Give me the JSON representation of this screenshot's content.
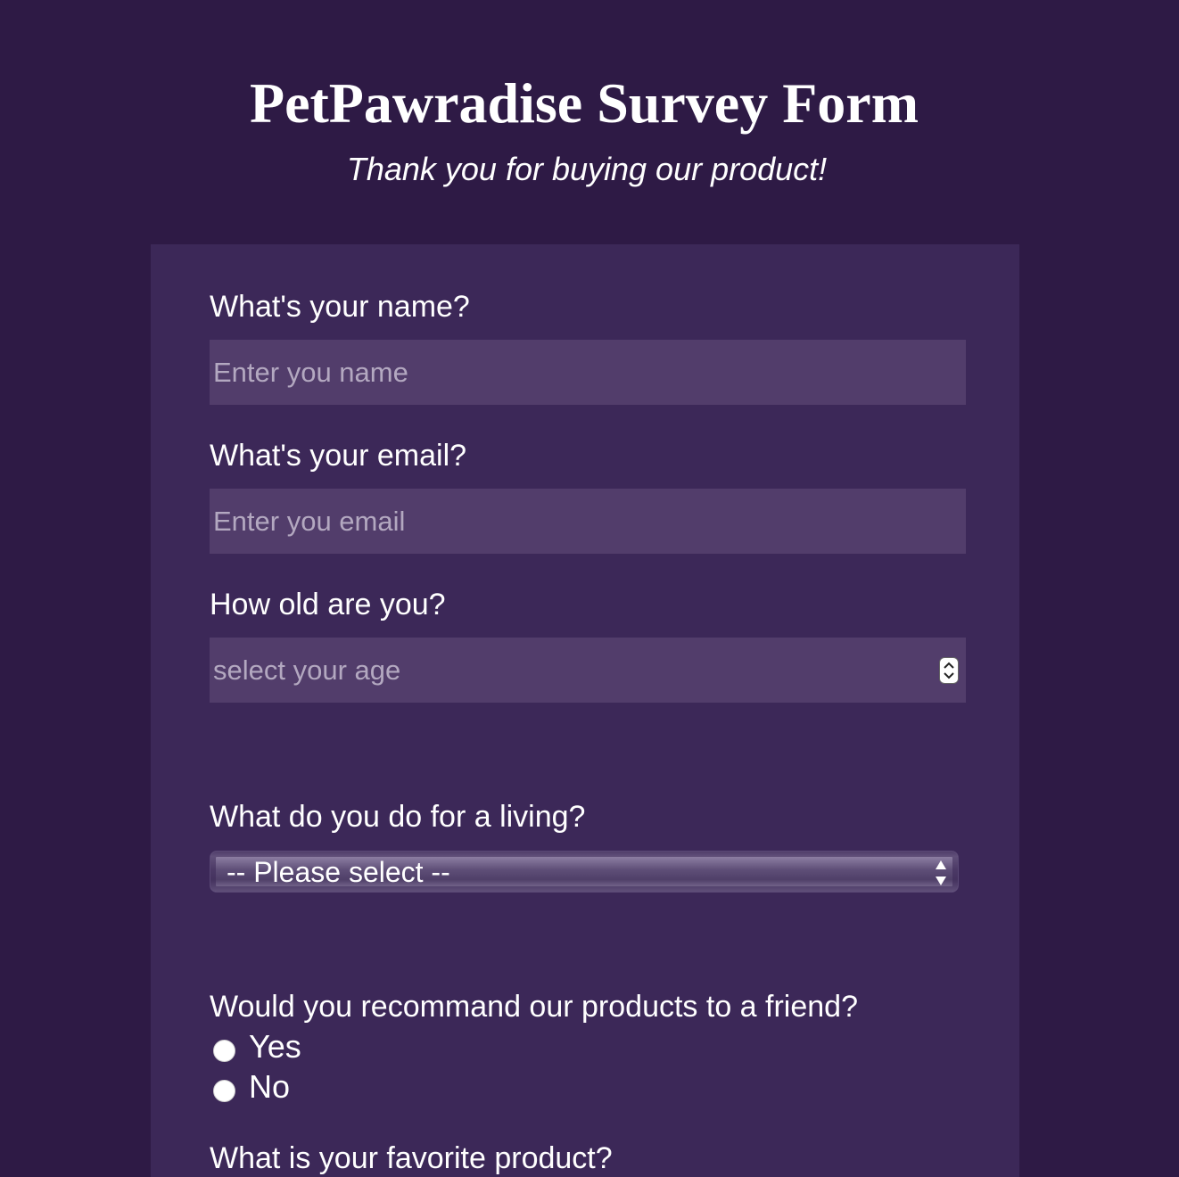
{
  "header": {
    "title": "PetPawradise Survey Form",
    "subtitle": "Thank you for buying our product!"
  },
  "form": {
    "name": {
      "label": "What's your name?",
      "placeholder": "Enter you name"
    },
    "email": {
      "label": "What's your email?",
      "placeholder": "Enter you email"
    },
    "age": {
      "label": "How old are you?",
      "placeholder": "select your age",
      "spinner_icon": "number-spinner-icon"
    },
    "occupation": {
      "label": "What do you do for a living?",
      "selected": "-- Please select --",
      "arrow_icon": "select-arrows-icon"
    },
    "recommend": {
      "label": "Would you recommand our products to a friend?",
      "options": [
        "Yes",
        "No"
      ]
    },
    "favorite": {
      "label": "What is your favorite product?"
    }
  },
  "colors": {
    "page_background": "#2e1a45",
    "card_background": "#3c2858",
    "input_background": "#523d6b",
    "text": "#ffffff",
    "placeholder": "#b3a8c0"
  }
}
